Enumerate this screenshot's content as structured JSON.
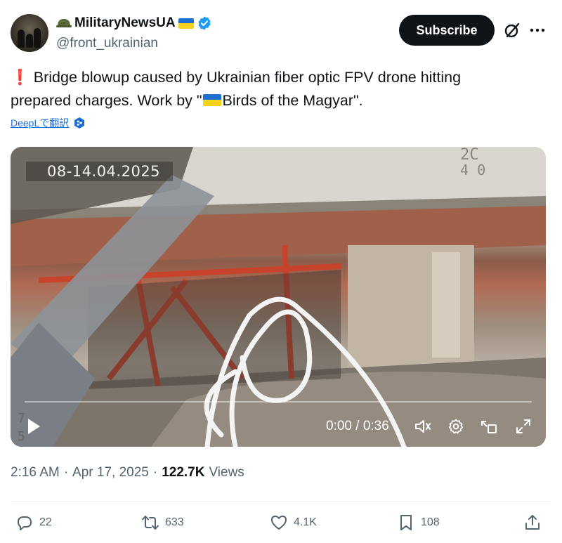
{
  "header": {
    "display_name": "MilitaryNewsUA",
    "handle": "@front_ukrainian",
    "subscribe_label": "Subscribe"
  },
  "tweet": {
    "exclaim": "❗",
    "line_1": "Bridge blowup caused by Ukrainian fiber optic FPV drone hitting",
    "line_2_a": "prepared charges. Work by \"",
    "line_2_b": "Birds of the Magyar\".",
    "translate_label": "DeepLで翻訳"
  },
  "video": {
    "timestamp_overlay": "08-14.04.2025",
    "time_display": "0:00 / 0:36",
    "progress": 0
  },
  "meta": {
    "time": "2:16 AM",
    "date": "Apr 17, 2025",
    "views_count": "122.7K",
    "views_label": "Views"
  },
  "actions": {
    "replies": "22",
    "reposts": "633",
    "likes": "4.1K",
    "bookmarks": "108"
  },
  "colors": {
    "verified": "#1d9bf0",
    "subscribe_bg": "#0f1419",
    "flag_blue": "#1f6fd0",
    "flag_yellow": "#f7d21c",
    "link": "#1d6fd6"
  },
  "icons": [
    "helmet-icon",
    "ukraine-flag-icon",
    "verified-badge-icon",
    "grok-icon",
    "more-icon",
    "deepl-icon",
    "play-icon",
    "volume-icon",
    "settings-icon",
    "pip-icon",
    "fullscreen-icon",
    "reply-icon",
    "repost-icon",
    "like-icon",
    "bookmark-icon",
    "share-icon"
  ]
}
